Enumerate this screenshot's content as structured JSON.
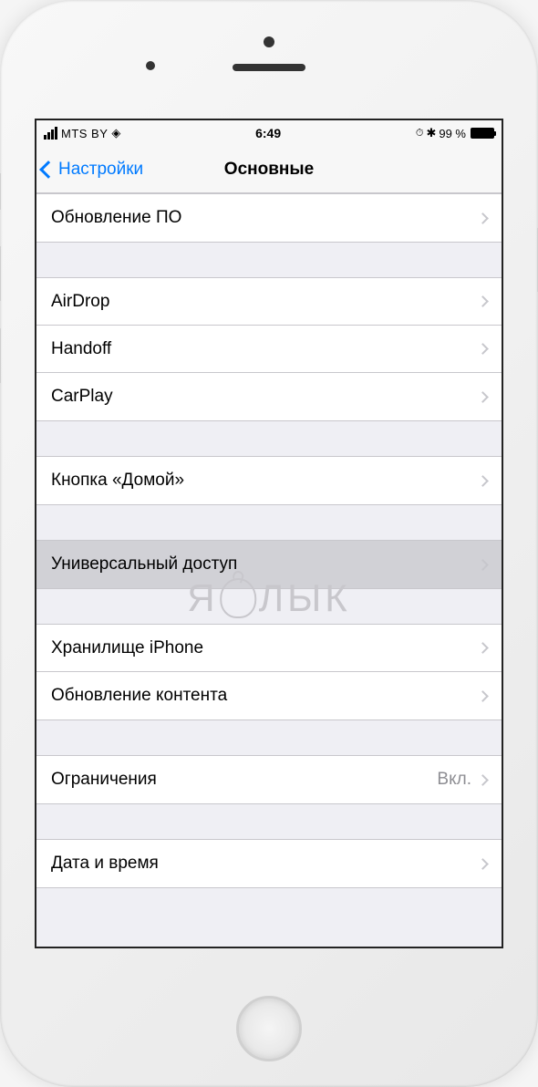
{
  "status_bar": {
    "carrier": "MTS BY",
    "time": "6:49",
    "battery_percent": "99 %",
    "alarm_icon": "⏰",
    "bluetooth_icon": "✽"
  },
  "nav": {
    "back_label": "Настройки",
    "title": "Основные"
  },
  "sections": [
    {
      "rows": [
        {
          "label": "Обновление ПО",
          "value": "",
          "selected": false
        }
      ]
    },
    {
      "rows": [
        {
          "label": "AirDrop",
          "value": "",
          "selected": false
        },
        {
          "label": "Handoff",
          "value": "",
          "selected": false
        },
        {
          "label": "CarPlay",
          "value": "",
          "selected": false
        }
      ]
    },
    {
      "rows": [
        {
          "label": "Кнопка «Домой»",
          "value": "",
          "selected": false
        }
      ]
    },
    {
      "rows": [
        {
          "label": "Универсальный доступ",
          "value": "",
          "selected": true
        }
      ]
    },
    {
      "rows": [
        {
          "label": "Хранилище iPhone",
          "value": "",
          "selected": false
        },
        {
          "label": "Обновление контента",
          "value": "",
          "selected": false
        }
      ]
    },
    {
      "rows": [
        {
          "label": "Ограничения",
          "value": "Вкл.",
          "selected": false
        }
      ]
    },
    {
      "rows": [
        {
          "label": "Дата и время",
          "value": "",
          "selected": false
        }
      ]
    }
  ],
  "watermark": {
    "pre": "Я",
    "post": "ЛЫК"
  }
}
